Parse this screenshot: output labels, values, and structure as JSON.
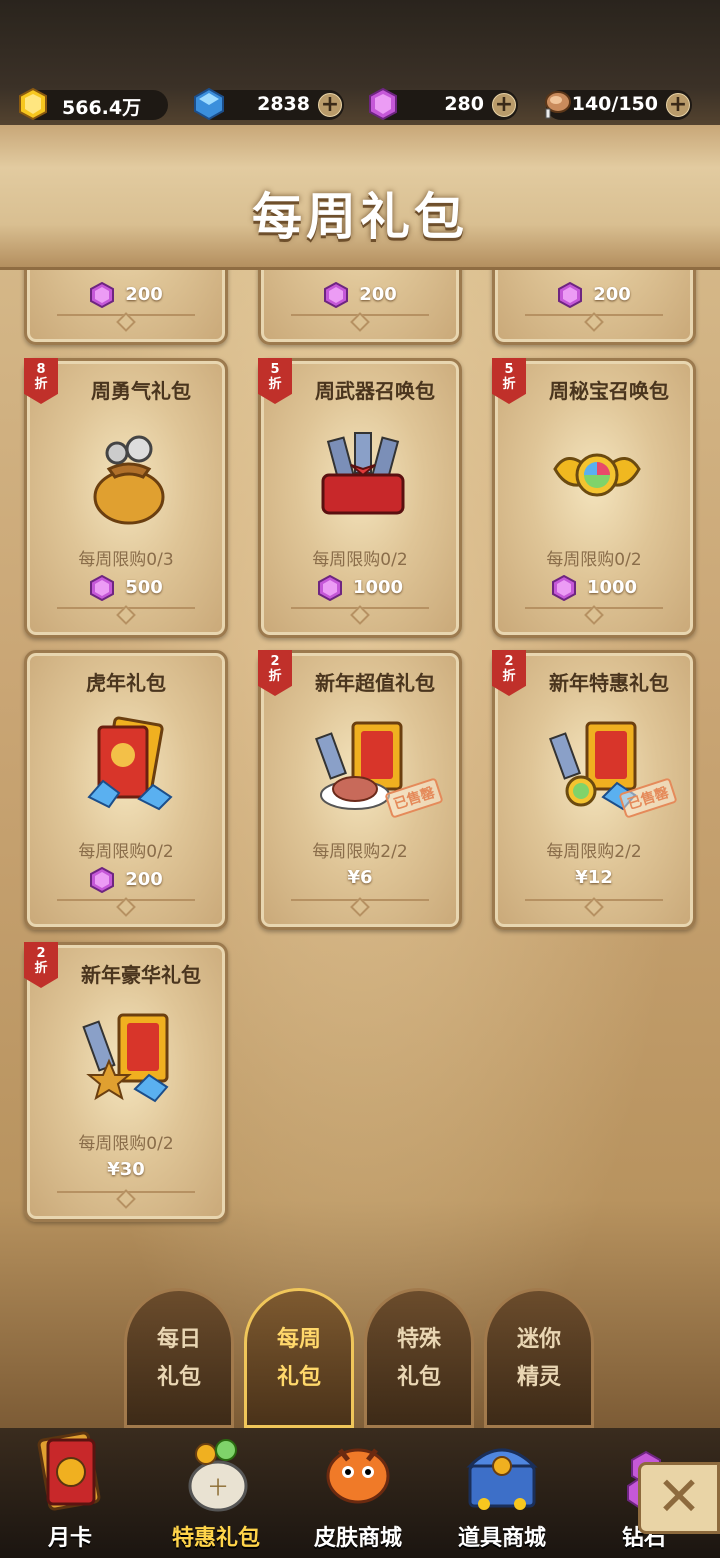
{
  "resources": [
    {
      "name": "gold",
      "value": "566.4万",
      "has_plus": false,
      "color": "#f5c52a"
    },
    {
      "name": "diamond",
      "value": "2838",
      "has_plus": true,
      "color": "#4aa6ea"
    },
    {
      "name": "purple-gem",
      "value": "280",
      "has_plus": true,
      "color": "#c85fd6"
    },
    {
      "name": "stamina-meat",
      "value": "140/150",
      "has_plus": true,
      "color": "#c98b5c"
    }
  ],
  "page_title": "每周礼包",
  "top_partial_prices": [
    "200",
    "200",
    "200"
  ],
  "cards": [
    {
      "name": "周勇气礼包",
      "discount": "8",
      "discount_unit": "折",
      "limit": "每周限购0/3",
      "price": "500",
      "currency": "gem",
      "icon": "bag-icon",
      "sold_out": ""
    },
    {
      "name": "周武器召唤包",
      "discount": "5",
      "discount_unit": "折",
      "limit": "每周限购0/2",
      "price": "1000",
      "currency": "gem",
      "icon": "ticket-box-icon",
      "sold_out": ""
    },
    {
      "name": "周秘宝召唤包",
      "discount": "5",
      "discount_unit": "折",
      "limit": "每周限购0/2",
      "price": "1000",
      "currency": "gem",
      "icon": "winged-orb-icon",
      "sold_out": ""
    },
    {
      "name": "虎年礼包",
      "discount": "",
      "discount_unit": "",
      "limit": "每周限购0/2",
      "price": "200",
      "currency": "gem",
      "icon": "red-envelope-icon",
      "sold_out": ""
    },
    {
      "name": "新年超值礼包",
      "discount": "2",
      "discount_unit": "折",
      "limit": "每周限购2/2",
      "price": "¥6",
      "currency": "rmb",
      "icon": "meat-envelope-icon",
      "sold_out": "已售罄"
    },
    {
      "name": "新年特惠礼包",
      "discount": "2",
      "discount_unit": "折",
      "limit": "每周限购2/2",
      "price": "¥12",
      "currency": "rmb",
      "icon": "envelope-orb-icon",
      "sold_out": "已售罄"
    },
    {
      "name": "新年豪华礼包",
      "discount": "2",
      "discount_unit": "折",
      "limit": "每周限购0/2",
      "price": "¥30",
      "currency": "rmb",
      "icon": "envelope-star-icon",
      "sold_out": ""
    }
  ],
  "tabs": [
    {
      "line1": "每日",
      "line2": "礼包",
      "active": false
    },
    {
      "line1": "每周",
      "line2": "礼包",
      "active": true
    },
    {
      "line1": "特殊",
      "line2": "礼包",
      "active": false
    },
    {
      "line1": "迷你",
      "line2": "精灵",
      "active": false
    }
  ],
  "nav": [
    {
      "label": "月卡",
      "icon": "card-icon",
      "active": false
    },
    {
      "label": "特惠礼包",
      "icon": "gift-sack-icon",
      "active": true
    },
    {
      "label": "皮肤商城",
      "icon": "dragon-icon",
      "active": false
    },
    {
      "label": "道具商城",
      "icon": "treasure-chest-icon",
      "active": false
    },
    {
      "label": "钻石",
      "icon": "gem-pile-icon",
      "active": false
    }
  ],
  "close_label": "✕"
}
